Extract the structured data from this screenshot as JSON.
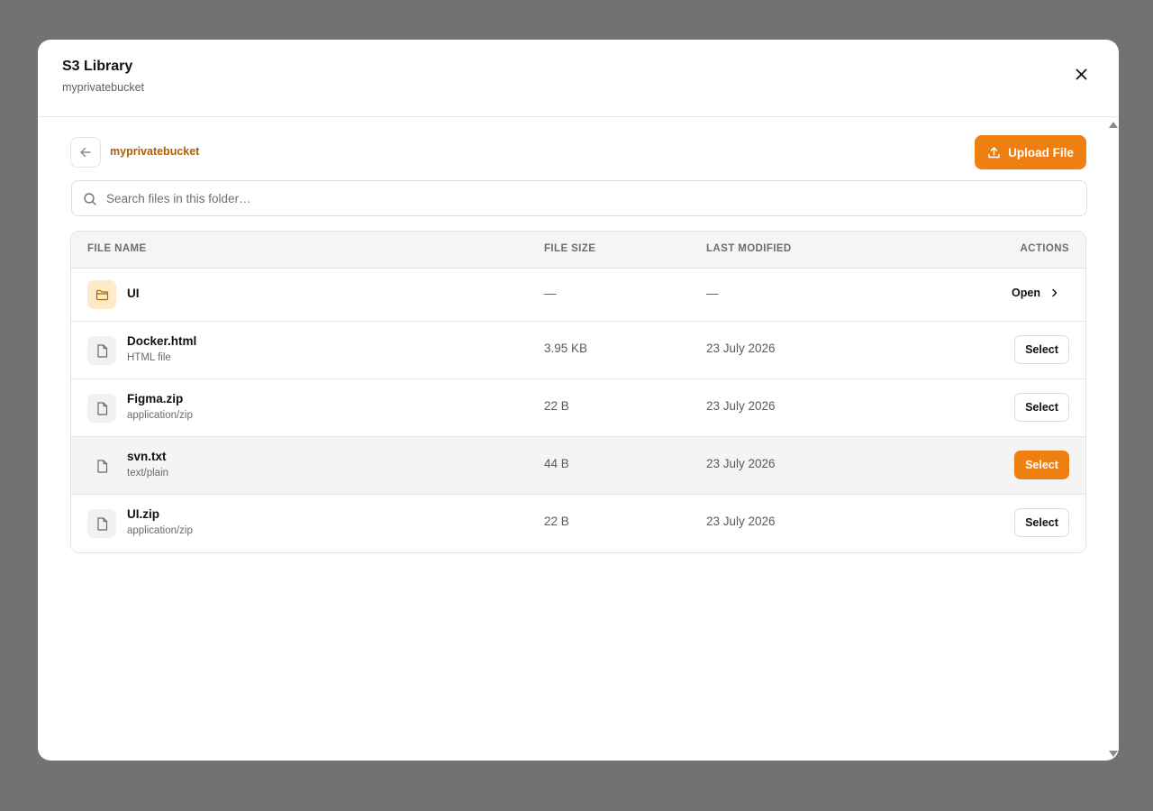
{
  "dialog": {
    "title": "S3 Library",
    "subtitle": "myprivatebucket",
    "close_icon": "close-icon"
  },
  "toolbar": {
    "back_icon": "arrow-left-icon",
    "breadcrumb": "myprivatebucket",
    "upload_label": "Upload File",
    "upload_icon": "upload-icon",
    "accent_color": "#f07f12"
  },
  "search": {
    "placeholder": "Search files in this folder…",
    "value": ""
  },
  "table": {
    "columns": {
      "name": "FILE NAME",
      "size": "FILE SIZE",
      "modified": "LAST MODIFIED",
      "actions": "ACTIONS"
    },
    "folder": {
      "name": "UI",
      "size": "—",
      "modified": "—",
      "action": "Open",
      "icon": "folder-icon"
    },
    "files": [
      {
        "name": "Docker.html",
        "type": "HTML file",
        "size": "3.95 KB",
        "modified": "23 July 2026",
        "action": "Select",
        "icon": "file-icon"
      },
      {
        "name": "Figma.zip",
        "type": "application/zip",
        "size": "22 B",
        "modified": "23 July 2026",
        "action": "Select",
        "icon": "file-icon"
      },
      {
        "name": "svn.txt",
        "type": "text/plain",
        "size": "44 B",
        "modified": "23 July 2026",
        "action": "Select",
        "icon": "file-icon"
      },
      {
        "name": "UI.zip",
        "type": "application/zip",
        "size": "22 B",
        "modified": "23 July 2026",
        "action": "Select",
        "icon": "file-icon"
      }
    ]
  }
}
